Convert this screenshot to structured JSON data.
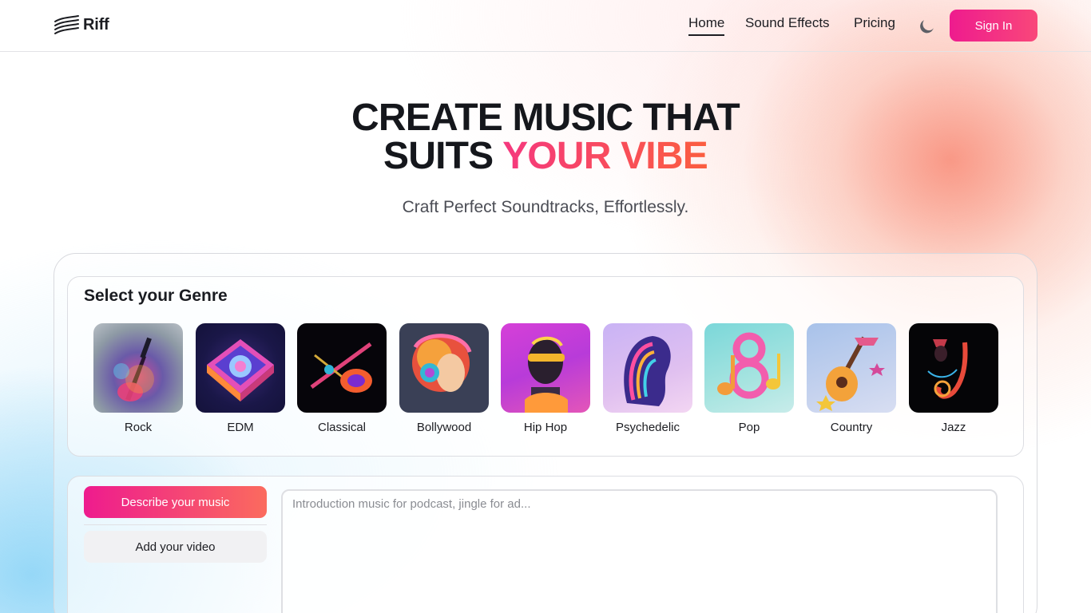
{
  "header": {
    "logo_text": "Riff",
    "nav": [
      {
        "label": "Home",
        "active": true
      },
      {
        "label": "Sound Effects",
        "active": false
      },
      {
        "label": "Pricing",
        "active": false
      }
    ],
    "theme_toggle_icon": "moon-icon",
    "sign_in_label": "Sign In"
  },
  "hero": {
    "title_line1": "CREATE MUSIC THAT",
    "title_line2_plain": "SUITS ",
    "title_line2_highlight": "YOUR VIBE",
    "subtitle": "Craft Perfect Soundtracks, Effortlessly."
  },
  "genre_section": {
    "heading": "Select your Genre",
    "genres": [
      {
        "label": "Rock"
      },
      {
        "label": "EDM"
      },
      {
        "label": "Classical"
      },
      {
        "label": "Bollywood"
      },
      {
        "label": "Hip Hop"
      },
      {
        "label": "Psychedelic"
      },
      {
        "label": "Pop"
      },
      {
        "label": "Country"
      },
      {
        "label": "Jazz"
      }
    ]
  },
  "prompt_section": {
    "tab_describe_label": "Describe your music",
    "tab_video_label": "Add your video",
    "input_placeholder": "Introduction music for podcast, jingle for ad...",
    "input_value": ""
  },
  "colors": {
    "accent_start": "#ee1b8e",
    "accent_end": "#fb5e3f",
    "text_primary": "#15171c"
  }
}
